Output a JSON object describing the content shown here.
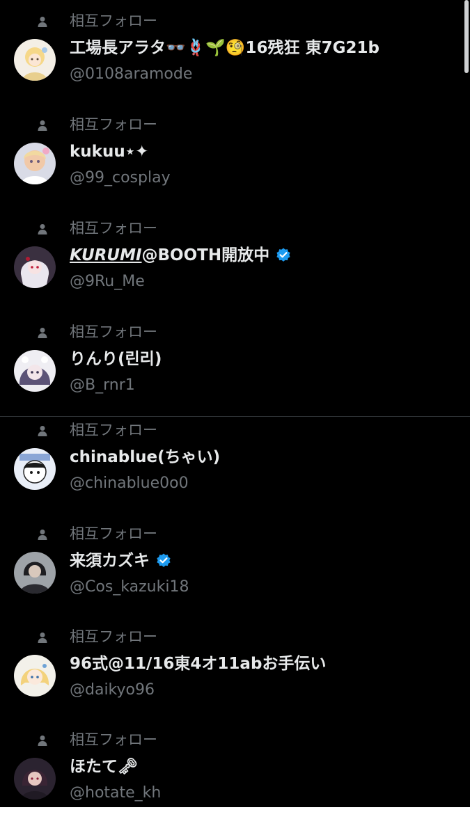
{
  "social_context_label": "相互フォロー",
  "accounts": [
    {
      "display_name": "工場長アラタ👓🪢🌱🧐16残狂 東7G21b",
      "handle": "@0108aramode",
      "verified": false,
      "avatar_icon": "avatar-anime-blonde-icon"
    },
    {
      "display_name": "kukuu⋆✦",
      "handle": "@99_cosplay",
      "verified": false,
      "avatar_icon": "avatar-cosplay-photo-icon"
    },
    {
      "display_name_emphasis": "KURUMI",
      "display_name": "@BOOTH開放中",
      "handle": "@9Ru_Me",
      "verified": true,
      "avatar_icon": "avatar-anime-silver-hair-icon"
    },
    {
      "display_name": "りんり(린리)",
      "handle": "@B_rnr1",
      "verified": false,
      "avatar_icon": "avatar-anime-purple-hair-icon"
    },
    {
      "display_name": "chinablue(ちゃい)",
      "handle": "@chinablue0o0",
      "verified": false,
      "avatar_icon": "avatar-chibi-character-icon"
    },
    {
      "display_name": "来須カズキ",
      "handle": "@Cos_kazuki18",
      "verified": true,
      "avatar_icon": "avatar-cosplay-dark-photo-icon"
    },
    {
      "display_name": "96式@11/16東4オ11abお手伝い",
      "handle": "@daikyo96",
      "verified": false,
      "avatar_icon": "avatar-anime-blonde-girl-icon"
    },
    {
      "display_name": "ほたて🗝",
      "handle": "@hotate_kh",
      "verified": false,
      "avatar_icon": "avatar-cosplay-portrait-icon"
    }
  ],
  "colors": {
    "background": "#000000",
    "primary_text": "#e7e9ea",
    "secondary_text": "#71767b",
    "verified_blue": "#1d9bf0",
    "divider": "#2f3336"
  }
}
